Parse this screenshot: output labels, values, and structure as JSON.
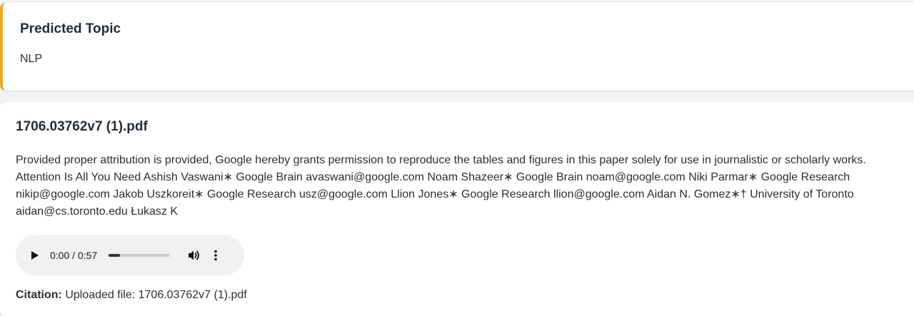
{
  "topic_card": {
    "heading": "Predicted Topic",
    "value": "NLP",
    "accent_color": "#f0a91c"
  },
  "document": {
    "title": "1706.03762v7 (1).pdf",
    "excerpt": "Provided proper attribution is provided, Google hereby grants permission to reproduce the tables and figures in this paper solely for use in journalistic or scholarly works. Attention Is All You Need Ashish Vaswani∗ Google Brain avaswani@google.com Noam Shazeer∗ Google Brain noam@google.com Niki Parmar∗ Google Research nikip@google.com Jakob Uszkoreit∗ Google Research usz@google.com Llion Jones∗ Google Research llion@google.com Aidan N. Gomez∗† University of Toronto aidan@cs.toronto.edu Łukasz K",
    "audio": {
      "time": "0:00 / 0:57",
      "progress_fraction": 0.18,
      "icons": [
        "play-icon",
        "volume-icon",
        "more-options-icon"
      ]
    },
    "citation_label": "Citation:",
    "citation_value": "Uploaded file: 1706.03762v7 (1).pdf"
  }
}
